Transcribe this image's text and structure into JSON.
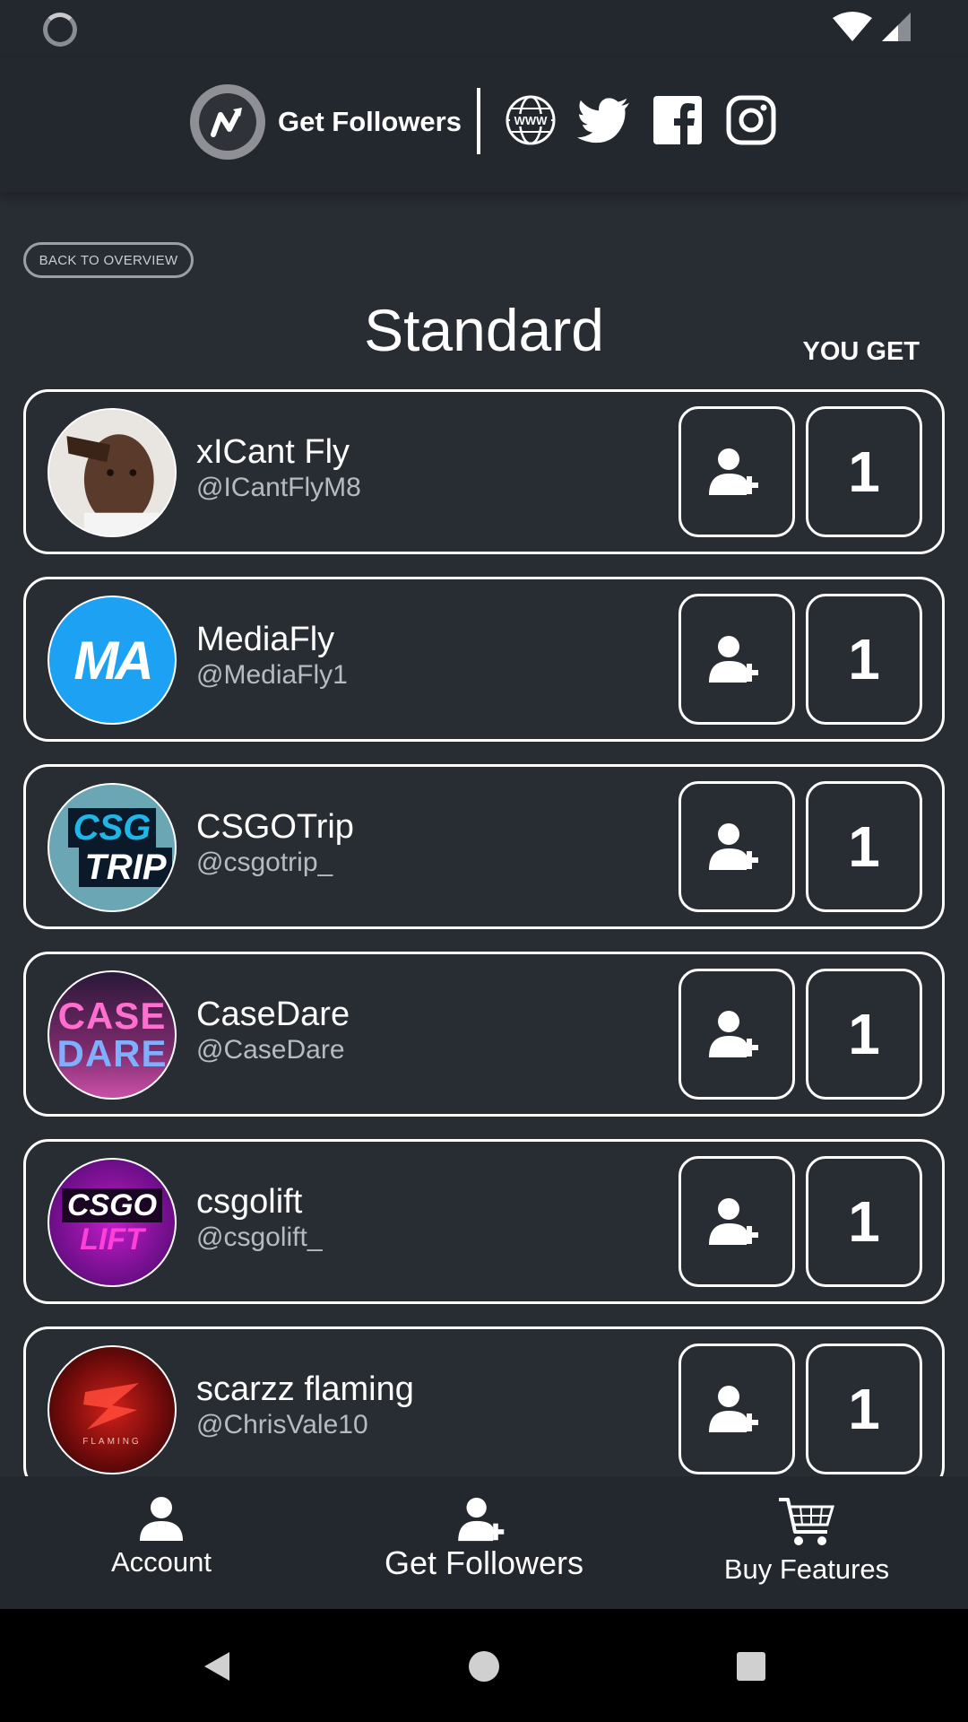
{
  "header": {
    "brand_name": "Get Followers",
    "socials": [
      "www-globe-icon",
      "twitter-icon",
      "facebook-icon",
      "instagram-icon"
    ]
  },
  "back_label": "BACK TO OVERVIEW",
  "page_title": "Standard",
  "you_get_label": "YOU GET",
  "users": [
    {
      "name": "xICant Fly",
      "handle": "@ICantFlyM8",
      "reward": "1",
      "avatar_color": "#d8d2cc"
    },
    {
      "name": "MediaFly",
      "handle": "@MediaFly1",
      "reward": "1",
      "avatar_color": "#1da1f2"
    },
    {
      "name": "CSGOTrip",
      "handle": "@csgotrip_",
      "reward": "1",
      "avatar_color": "#3b6f7f"
    },
    {
      "name": "CaseDare",
      "handle": "@CaseDare",
      "reward": "1",
      "avatar_color": "#5a2b6b"
    },
    {
      "name": "csgolift",
      "handle": "@csgolift_",
      "reward": "1",
      "avatar_color": "#8a1a9e"
    },
    {
      "name": "scarzz flaming",
      "handle": "@ChrisVale10",
      "reward": "1",
      "avatar_color": "#7a1010"
    }
  ],
  "avatar_text": {
    "mediafly": "MA",
    "csgotrip_top": "CSG",
    "csgotrip_bottom": "TRIP",
    "casedare_top": "CASE",
    "casedare_bottom": "DARE",
    "csgolift_top": "CSGO",
    "csgolift_bottom": "LIFT",
    "scarzz_bottom": "FLAMING"
  },
  "bottom_nav": {
    "account": "Account",
    "get_followers": "Get Followers",
    "buy_features": "Buy Features"
  },
  "colors": {
    "background": "#282c33",
    "bar": "#23272e",
    "border": "#ffffff",
    "muted_text": "#b7bbc1"
  }
}
